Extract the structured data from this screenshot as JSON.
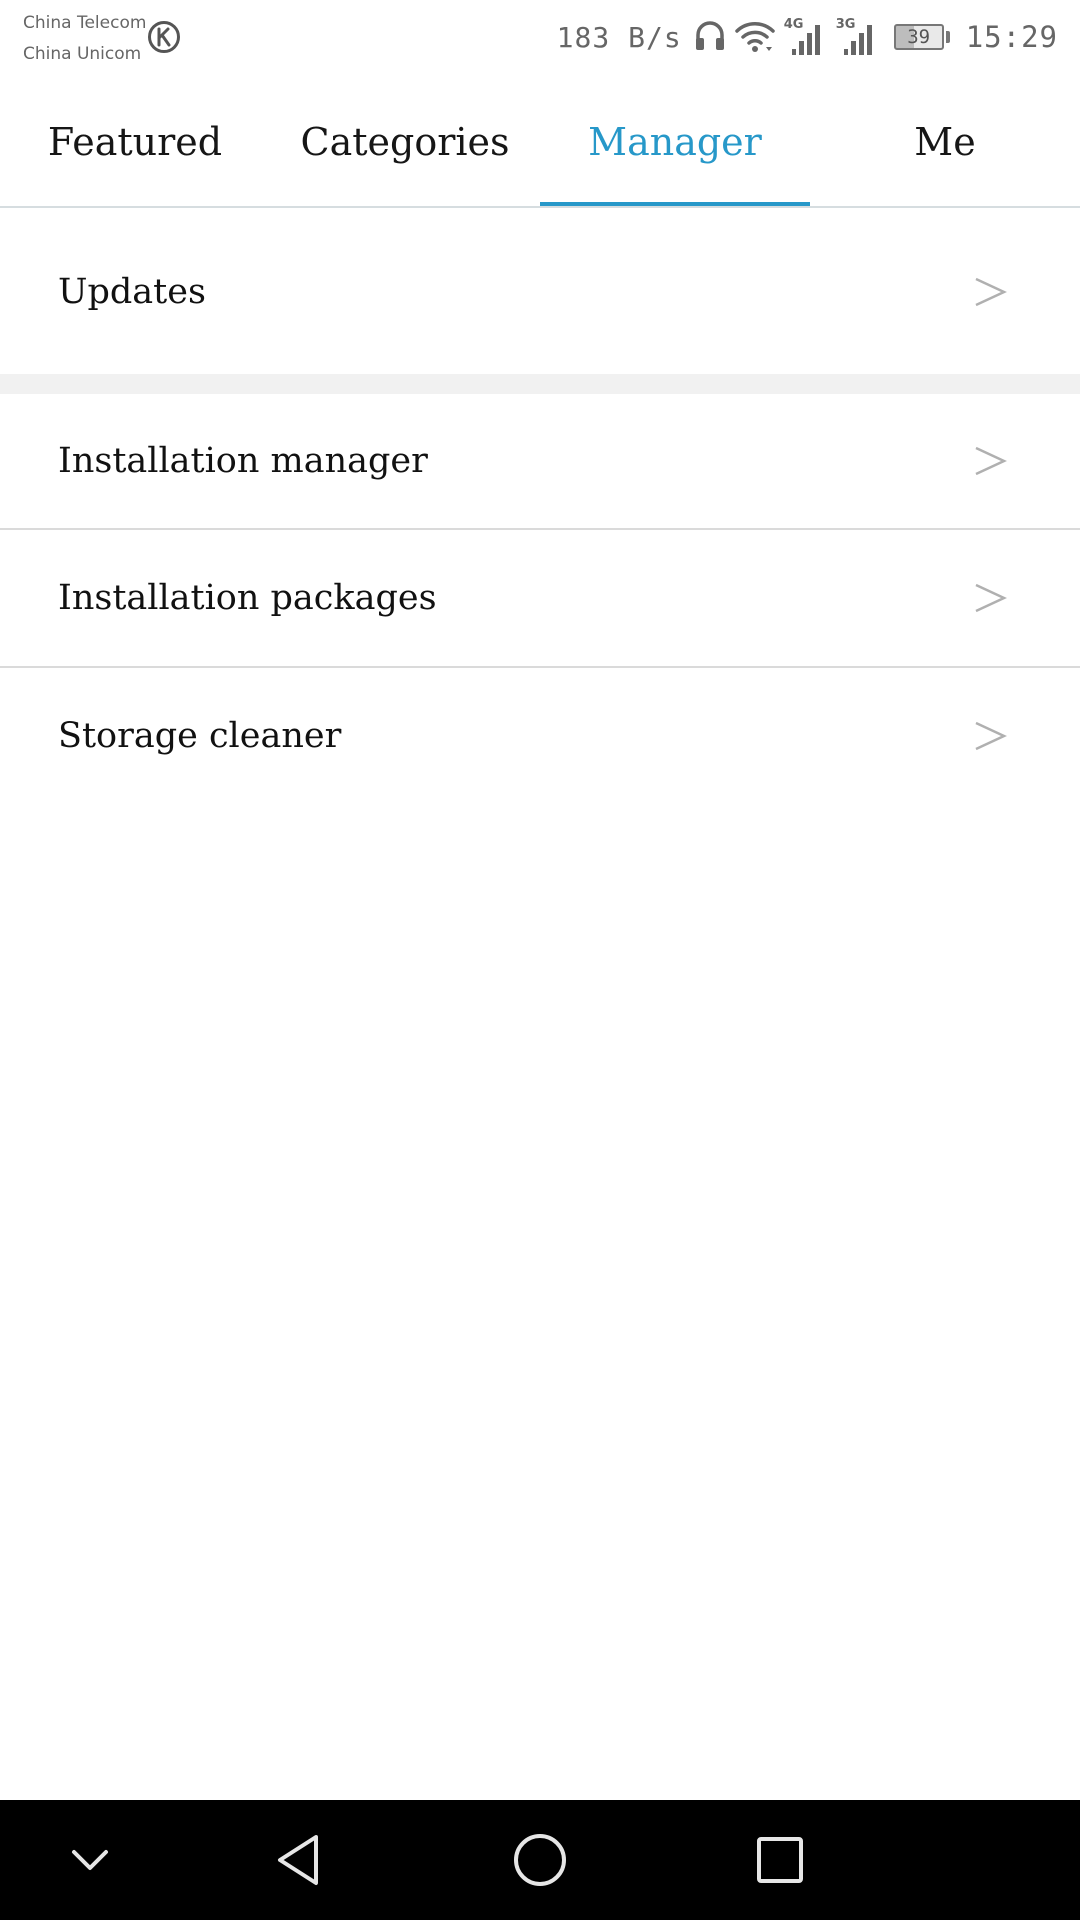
{
  "status_bar": {
    "carriers": [
      "China Telecom",
      "China Unicom"
    ],
    "app_badge_icon": "k-circle-icon",
    "net_speed": "183 B/s",
    "network_1": "4G",
    "network_2": "3G",
    "battery_level": "39",
    "time": "15:29"
  },
  "tabs": [
    {
      "label": "Featured",
      "active": false
    },
    {
      "label": "Categories",
      "active": false
    },
    {
      "label": "Manager",
      "active": true
    },
    {
      "label": "Me",
      "active": false
    }
  ],
  "colors": {
    "accent": "#2798c9",
    "divider": "#dadada",
    "section_gap": "#f1f1f1",
    "navbar": "#000000"
  },
  "menu": {
    "updates": "Updates",
    "installation_manager": "Installation manager",
    "installation_packages": "Installation packages",
    "storage_cleaner": "Storage cleaner",
    "chevron_icon": "chevron-right-icon"
  },
  "navbar": {
    "icons": [
      "chevron-down-icon",
      "back-triangle-icon",
      "home-circle-icon",
      "recents-square-icon"
    ]
  }
}
